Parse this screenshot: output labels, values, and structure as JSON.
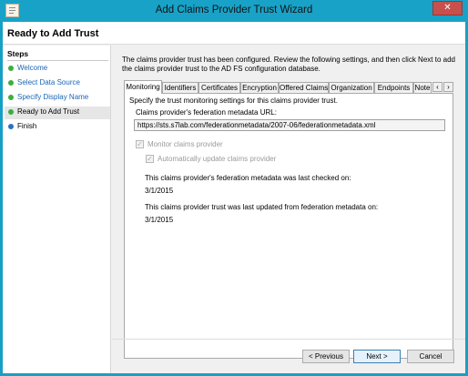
{
  "window": {
    "title": "Add Claims Provider Trust Wizard",
    "close_glyph": "✕"
  },
  "page": {
    "heading": "Ready to Add Trust"
  },
  "steps": {
    "title": "Steps",
    "items": [
      {
        "label": "Welcome",
        "state": "done"
      },
      {
        "label": "Select Data Source",
        "state": "done"
      },
      {
        "label": "Specify Display Name",
        "state": "done"
      },
      {
        "label": "Ready to Add Trust",
        "state": "current"
      },
      {
        "label": "Finish",
        "state": "pending"
      }
    ]
  },
  "intro_text": "The claims provider trust has been configured. Review the following settings, and then click Next to add the claims provider trust to the AD FS configuration database.",
  "tabs": [
    {
      "label": "Monitoring",
      "active": true
    },
    {
      "label": "Identifiers",
      "active": false
    },
    {
      "label": "Certificates",
      "active": false
    },
    {
      "label": "Encryption",
      "active": false
    },
    {
      "label": "Offered Claims",
      "active": false
    },
    {
      "label": "Organization",
      "active": false
    },
    {
      "label": "Endpoints",
      "active": false
    },
    {
      "label": "Note",
      "active": false
    }
  ],
  "tab_scroll": {
    "left": "‹",
    "right": "›"
  },
  "monitoring": {
    "description": "Specify the trust monitoring settings for this claims provider trust.",
    "url_label": "Claims provider's federation metadata URL:",
    "url_value": "https://sts.s7lab.com/federationmetadata/2007-06/federationmetadata.xml",
    "monitor_label": "Monitor claims provider",
    "monitor_checked": true,
    "auto_update_label": "Automatically update claims provider",
    "auto_update_checked": true,
    "last_checked_label": "This claims provider's federation metadata was last checked on:",
    "last_checked_value": "3/1/2015",
    "last_updated_label": "This claims provider trust was last updated from federation metadata on:",
    "last_updated_value": "3/1/2015"
  },
  "buttons": {
    "previous": "< Previous",
    "next": "Next >",
    "cancel": "Cancel"
  },
  "colors": {
    "titlebar": "#19a2c7",
    "step_done": "#3cae3c",
    "step_pending": "#2b71c4",
    "link": "#1a66b5"
  }
}
